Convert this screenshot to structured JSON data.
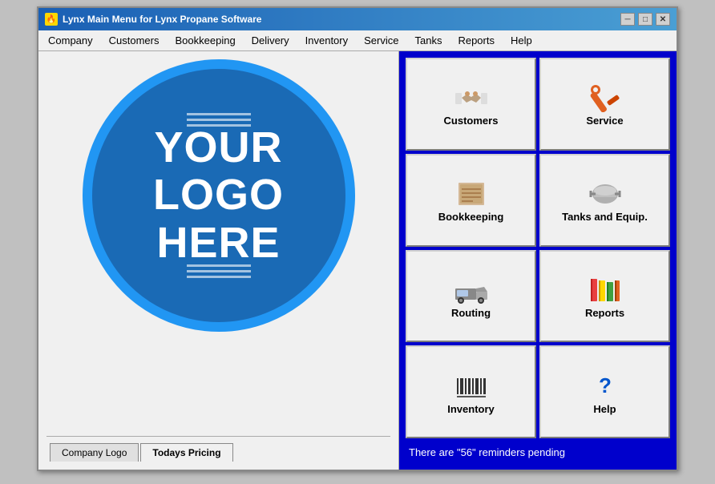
{
  "window": {
    "title": "Lynx Main Menu for Lynx Propane Software",
    "minimize_label": "─",
    "maximize_label": "□",
    "close_label": "✕"
  },
  "menubar": {
    "items": [
      {
        "label": "Company",
        "id": "company"
      },
      {
        "label": "Customers",
        "id": "customers"
      },
      {
        "label": "Bookkeeping",
        "id": "bookkeeping"
      },
      {
        "label": "Delivery",
        "id": "delivery"
      },
      {
        "label": "Inventory",
        "id": "inventory"
      },
      {
        "label": "Service",
        "id": "service"
      },
      {
        "label": "Tanks",
        "id": "tanks"
      },
      {
        "label": "Reports",
        "id": "reports"
      },
      {
        "label": "Help",
        "id": "help"
      }
    ]
  },
  "logo": {
    "line1": "YOUR",
    "line2": "LOGO",
    "line3": "HERE"
  },
  "tabs": [
    {
      "label": "Company Logo",
      "id": "company-logo",
      "active": true
    },
    {
      "label": "Todays Pricing",
      "id": "todays-pricing",
      "active": false
    }
  ],
  "buttons": [
    {
      "id": "customers",
      "label": "Customers",
      "icon_type": "customers"
    },
    {
      "id": "service",
      "label": "Service",
      "icon_type": "service"
    },
    {
      "id": "bookkeeping",
      "label": "Bookkeeping",
      "icon_type": "bookkeeping"
    },
    {
      "id": "tanks",
      "label": "Tanks and Equip.",
      "icon_type": "tanks"
    },
    {
      "id": "routing",
      "label": "Routing",
      "icon_type": "routing"
    },
    {
      "id": "reports",
      "label": "Reports",
      "icon_type": "reports"
    },
    {
      "id": "inventory",
      "label": "Inventory",
      "icon_type": "inventory"
    },
    {
      "id": "help-btn",
      "label": "Help",
      "icon_type": "help"
    }
  ],
  "reminders": {
    "text": "There are \"56\" reminders pending"
  },
  "colors": {
    "right_panel_bg": "#0000cc",
    "logo_circle": "#1a6ab5",
    "logo_border": "#2196F3"
  }
}
